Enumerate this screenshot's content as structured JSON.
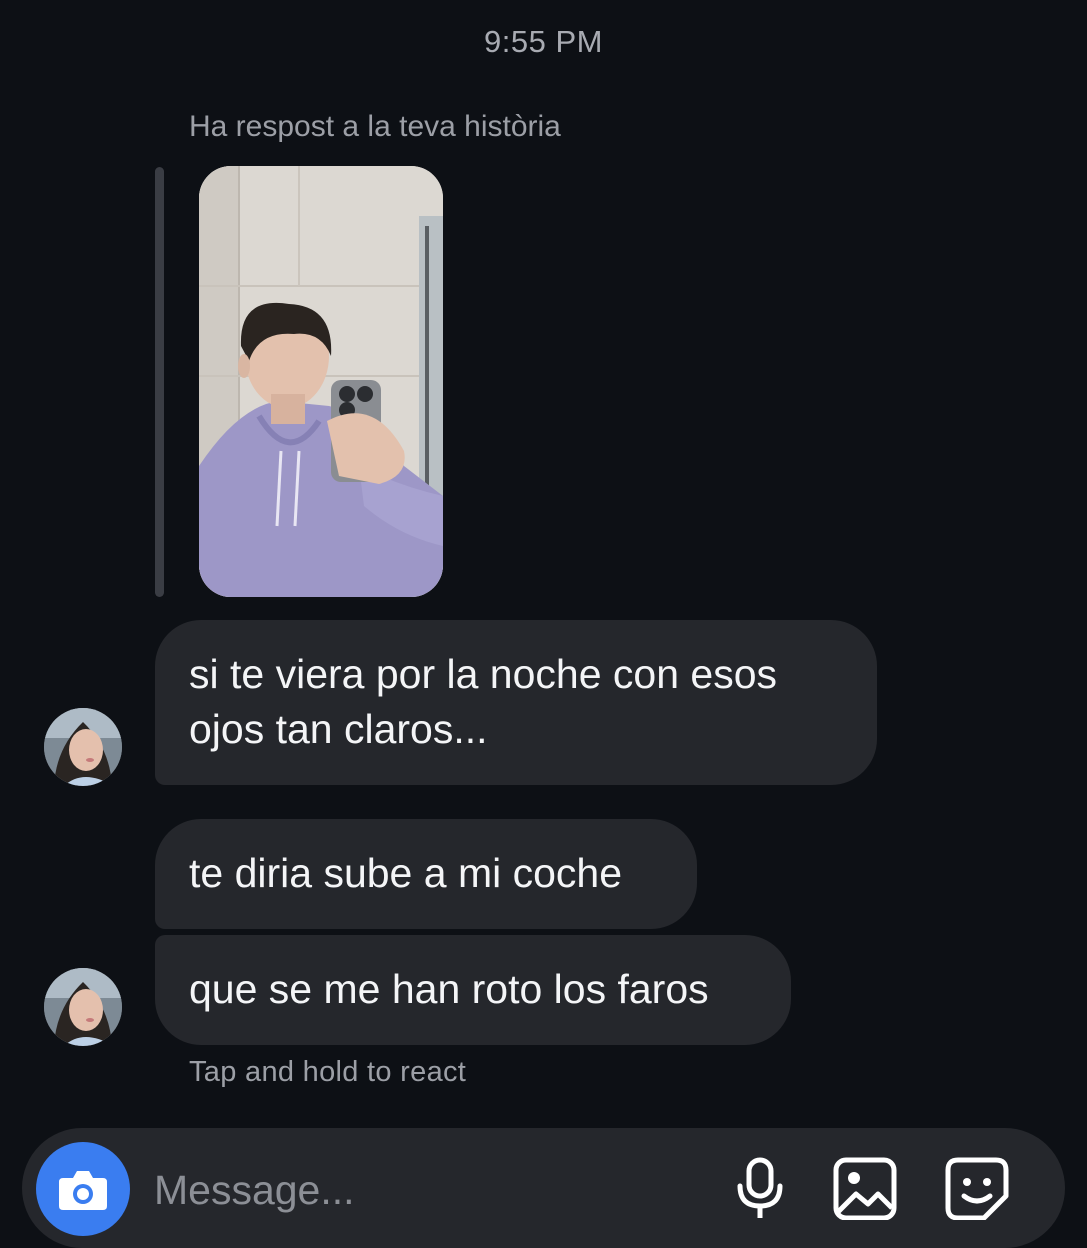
{
  "header": {
    "timestamp": "9:55 PM"
  },
  "thread": {
    "story_reply_label": "Ha respost a la teva història",
    "messages": [
      {
        "text": "si te viera por la noche con esos ojos tan claros..."
      },
      {
        "text": "te diria sube a mi coche"
      },
      {
        "text": "que se me han roto los faros"
      }
    ],
    "hint": "Tap and hold to react"
  },
  "composer": {
    "placeholder": "Message...",
    "icons": [
      "camera-icon",
      "microphone-icon",
      "gallery-icon",
      "sticker-icon"
    ]
  },
  "colors": {
    "background": "#0d1015",
    "bubble": "#25272c",
    "accent": "#3a7df0",
    "muted_text": "#9c9fa6"
  }
}
